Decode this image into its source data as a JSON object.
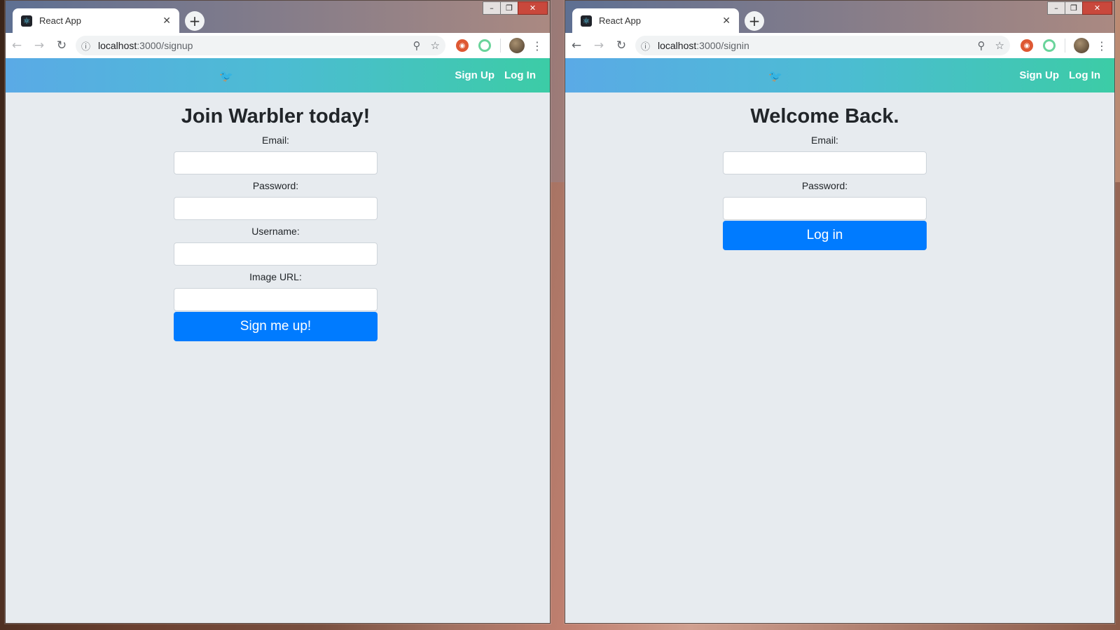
{
  "left_window": {
    "tab_title": "React App",
    "url_host": "localhost",
    "url_path": ":3000/signup",
    "nav": {
      "logo": "🐦",
      "signup": "Sign Up",
      "login": "Log In"
    },
    "form": {
      "heading": "Join Warbler today!",
      "fields": [
        "Email:",
        "Password:",
        "Username:",
        "Image URL:"
      ],
      "submit": "Sign me up!"
    }
  },
  "right_window": {
    "tab_title": "React App",
    "url_host": "localhost",
    "url_path": ":3000/signin",
    "nav": {
      "logo": "🐦",
      "signup": "Sign Up",
      "login": "Log In"
    },
    "form": {
      "heading": "Welcome Back.",
      "fields": [
        "Email:",
        "Password:"
      ],
      "submit": "Log in"
    }
  },
  "colors": {
    "primary": "#007bff",
    "nav_gradient_start": "#5aaae6",
    "nav_gradient_end": "#3ccca6",
    "page_bg": "#e7ebef"
  },
  "icons": {
    "back": "back-arrow-icon",
    "forward": "forward-arrow-icon",
    "reload": "reload-icon",
    "info": "info-icon",
    "zoom": "zoom-icon",
    "bookmark": "star-icon",
    "menu": "kebab-menu-icon"
  }
}
